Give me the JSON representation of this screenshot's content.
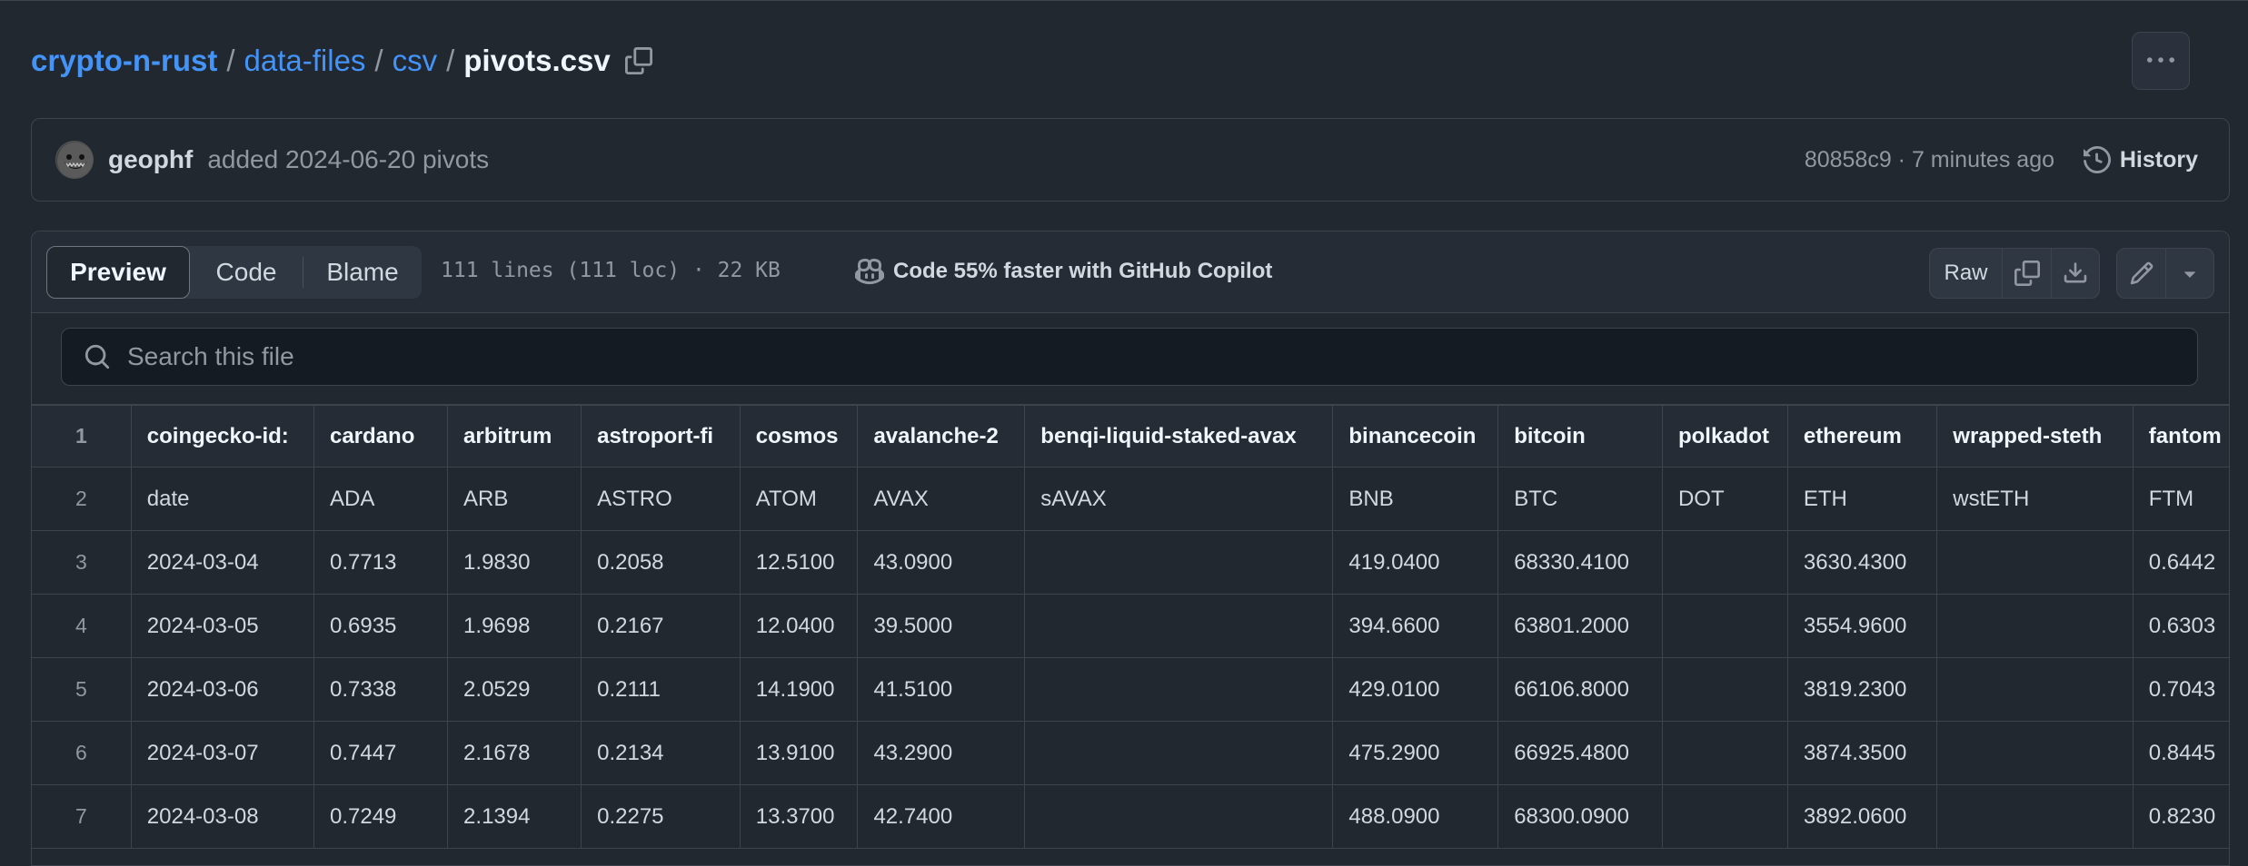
{
  "breadcrumb": {
    "repo": "crypto-n-rust",
    "folder1": "data-files",
    "folder2": "csv",
    "file": "pivots.csv",
    "sep": "/"
  },
  "commit": {
    "author": "geophf",
    "message": "added 2024-06-20 pivots",
    "meta": "80858c9 · 7 minutes ago",
    "history_label": "History"
  },
  "file_header": {
    "tabs": [
      {
        "label": "Preview",
        "active": true
      },
      {
        "label": "Code",
        "active": false
      },
      {
        "label": "Blame",
        "active": false
      }
    ],
    "info": "111 lines (111 loc) · 22 KB",
    "copilot": "Code 55% faster with GitHub Copilot",
    "raw_label": "Raw"
  },
  "search": {
    "placeholder": "Search this file"
  },
  "table": {
    "header": {
      "line": "1",
      "cells": [
        "coingecko-id:",
        "cardano",
        "arbitrum",
        "astroport-fi",
        "cosmos",
        "avalanche-2",
        "benqi-liquid-staked-avax",
        "binancecoin",
        "bitcoin",
        "polkadot",
        "ethereum",
        "wrapped-steth",
        "fantom"
      ]
    },
    "rows": [
      {
        "line": "2",
        "cells": [
          "date",
          "ADA",
          "ARB",
          "ASTRO",
          "ATOM",
          "AVAX",
          "sAVAX",
          "BNB",
          "BTC",
          "DOT",
          "ETH",
          "wstETH",
          "FTM"
        ]
      },
      {
        "line": "3",
        "cells": [
          "2024-03-04",
          "0.7713",
          "1.9830",
          "0.2058",
          "12.5100",
          "43.0900",
          "",
          "419.0400",
          "68330.4100",
          "",
          "3630.4300",
          "",
          "0.6442"
        ]
      },
      {
        "line": "4",
        "cells": [
          "2024-03-05",
          "0.6935",
          "1.9698",
          "0.2167",
          "12.0400",
          "39.5000",
          "",
          "394.6600",
          "63801.2000",
          "",
          "3554.9600",
          "",
          "0.6303"
        ]
      },
      {
        "line": "5",
        "cells": [
          "2024-03-06",
          "0.7338",
          "2.0529",
          "0.2111",
          "14.1900",
          "41.5100",
          "",
          "429.0100",
          "66106.8000",
          "",
          "3819.2300",
          "",
          "0.7043"
        ]
      },
      {
        "line": "6",
        "cells": [
          "2024-03-07",
          "0.7447",
          "2.1678",
          "0.2134",
          "13.9100",
          "43.2900",
          "",
          "475.2900",
          "66925.4800",
          "",
          "3874.3500",
          "",
          "0.8445"
        ]
      },
      {
        "line": "7",
        "cells": [
          "2024-03-08",
          "0.7249",
          "2.1394",
          "0.2275",
          "13.3700",
          "42.7400",
          "",
          "488.0900",
          "68300.0900",
          "",
          "3892.0600",
          "",
          "0.8230"
        ]
      }
    ]
  },
  "colors": {
    "bg": "#212830",
    "link": "#4493f8",
    "border": "#3d444d",
    "muted": "#9198a1"
  }
}
